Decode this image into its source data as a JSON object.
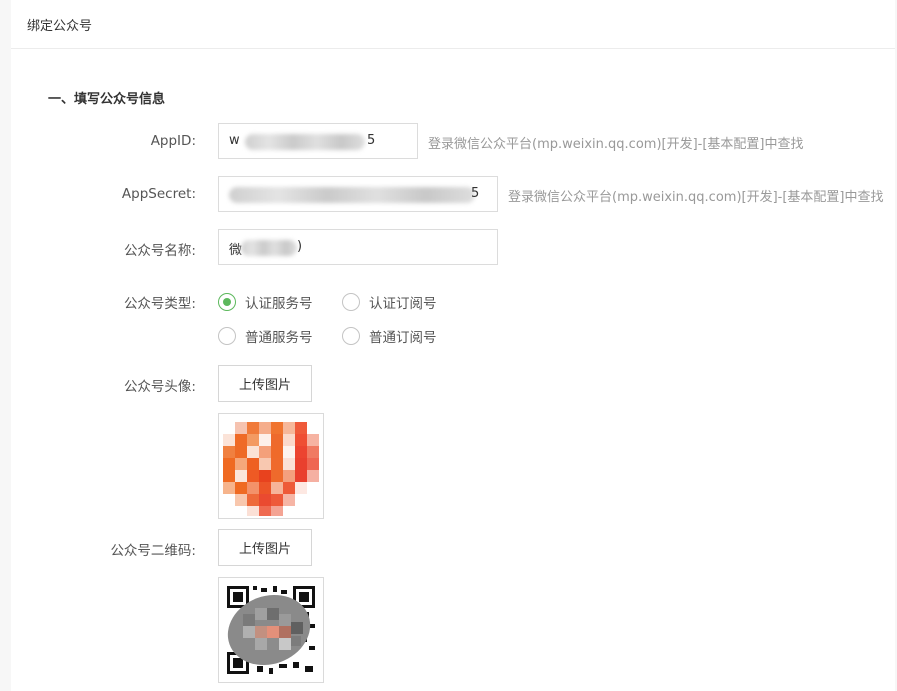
{
  "header": {
    "title": "绑定公众号"
  },
  "section": {
    "title": "一、填写公众号信息"
  },
  "fields": {
    "appid": {
      "label": "AppID:",
      "hint": "登录微信公众平台(mp.weixin.qq.com)[开发]-[基本配置]中查找",
      "value_visible_prefix": "w",
      "value_visible_suffix": "5"
    },
    "appsecret": {
      "label": "AppSecret:",
      "hint": "登录微信公众平台(mp.weixin.qq.com)[开发]-[基本配置]中查找",
      "value_visible_suffix": "5"
    },
    "name": {
      "label": "公众号名称:",
      "value_visible_prefix": "微",
      "value_visible_suffix": ")"
    },
    "type": {
      "label": "公众号类型:",
      "options": [
        "认证服务号",
        "认证订阅号",
        "普通服务号",
        "普通订阅号"
      ],
      "selected": "认证服务号"
    },
    "avatar": {
      "label": "公众号头像:",
      "button": "上传图片"
    },
    "qrcode": {
      "label": "公众号二维码:",
      "button": "上传图片"
    }
  },
  "colors": {
    "radio_checked": "#5cb85c",
    "hint": "#999999"
  }
}
